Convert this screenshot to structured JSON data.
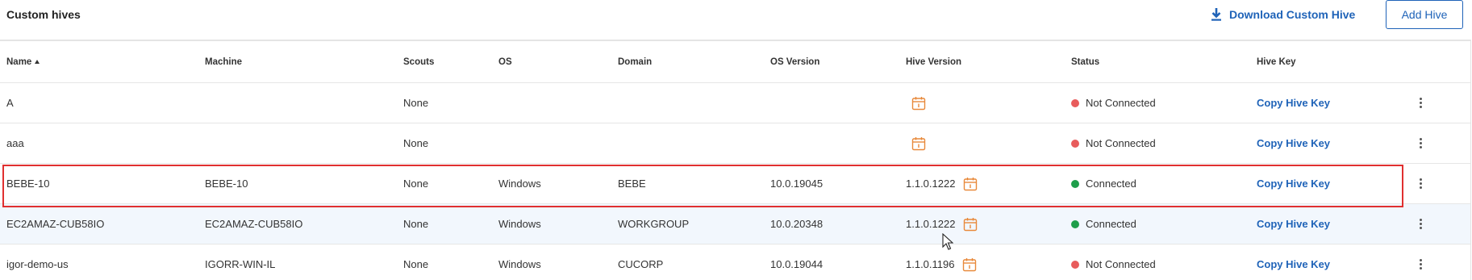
{
  "header": {
    "title": "Custom hives",
    "download_label": "Download Custom Hive",
    "add_label": "Add Hive"
  },
  "table": {
    "columns": {
      "name": "Name",
      "machine": "Machine",
      "scouts": "Scouts",
      "os": "OS",
      "domain": "Domain",
      "os_version": "OS Version",
      "hive_version": "Hive Version",
      "status": "Status",
      "hive_key": "Hive Key"
    },
    "sort": {
      "column": "Name",
      "direction": "ascending"
    },
    "rows": [
      {
        "name": "A",
        "machine": "",
        "scouts": "None",
        "os": "",
        "domain": "",
        "os_version": "",
        "hive_version": "",
        "status": "Not Connected",
        "status_color": "#e85c5c",
        "hive_key": "Copy Hive Key"
      },
      {
        "name": "aaa",
        "machine": "",
        "scouts": "None",
        "os": "",
        "domain": "",
        "os_version": "",
        "hive_version": "",
        "status": "Not Connected",
        "status_color": "#e85c5c",
        "hive_key": "Copy Hive Key"
      },
      {
        "name": "BEBE-10",
        "machine": "BEBE-10",
        "scouts": "None",
        "os": "Windows",
        "domain": "BEBE",
        "os_version": "10.0.19045",
        "hive_version": "1.1.0.1222",
        "status": "Connected",
        "status_color": "#1e9e4a",
        "hive_key": "Copy Hive Key"
      },
      {
        "name": "EC2AMAZ-CUB58IO",
        "machine": "EC2AMAZ-CUB58IO",
        "scouts": "None",
        "os": "Windows",
        "domain": "WORKGROUP",
        "os_version": "10.0.20348",
        "hive_version": "1.1.0.1222",
        "status": "Connected",
        "status_color": "#1e9e4a",
        "hive_key": "Copy Hive Key"
      },
      {
        "name": "igor-demo-us",
        "machine": "IGORR-WIN-IL",
        "scouts": "None",
        "os": "Windows",
        "domain": "CUCORP",
        "os_version": "10.0.19044",
        "hive_version": "1.1.0.1196",
        "status": "Not Connected",
        "status_color": "#e85c5c",
        "hive_key": "Copy Hive Key"
      }
    ]
  },
  "icons": {
    "download": "download-icon",
    "calendar": "calendar-icon",
    "menu": "kebab-menu-icon",
    "calendar_color": "#e8893a",
    "accent": "#1f63b8"
  }
}
